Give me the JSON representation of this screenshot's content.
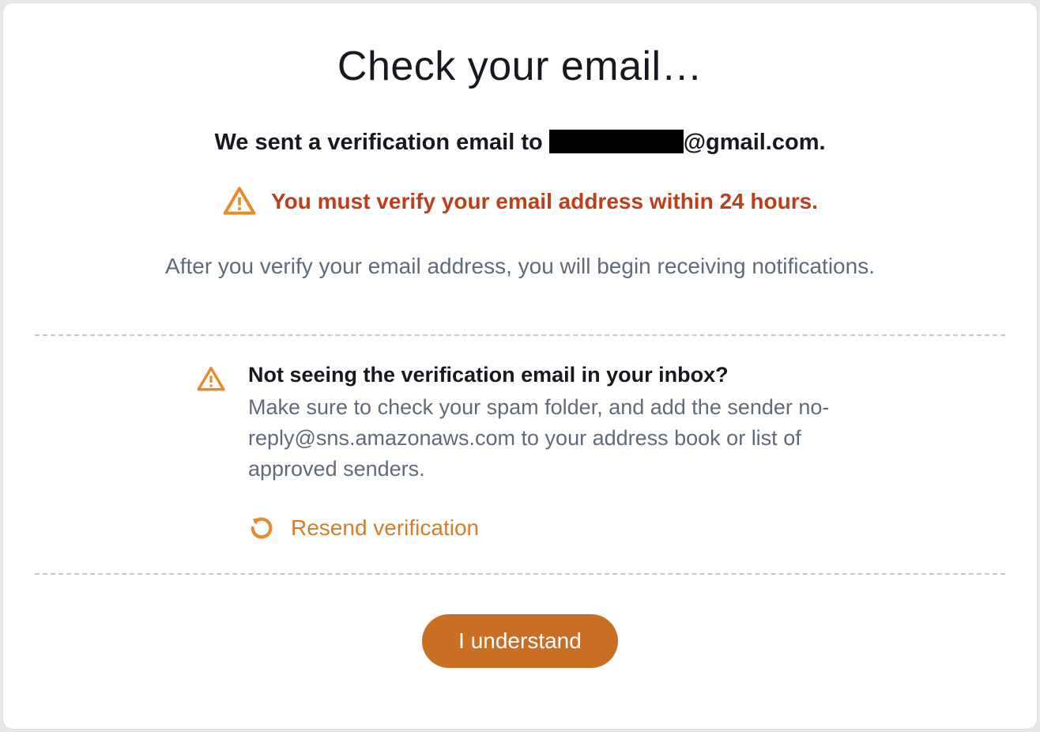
{
  "title": "Check your email…",
  "sent": {
    "prefix": "We sent a verification email to ",
    "email_domain": "@gmail.com."
  },
  "warning_text": "You must verify your email address within 24 hours.",
  "after_text": "After you verify your email address, you will begin receiving notifications.",
  "help": {
    "title": "Not seeing the verification email in your inbox?",
    "body": "Make sure to check your spam folder, and add the sender no-reply@sns.amazonaws.com to your address book or list of approved senders.",
    "resend_label": "Resend verification"
  },
  "cta_label": "I understand"
}
